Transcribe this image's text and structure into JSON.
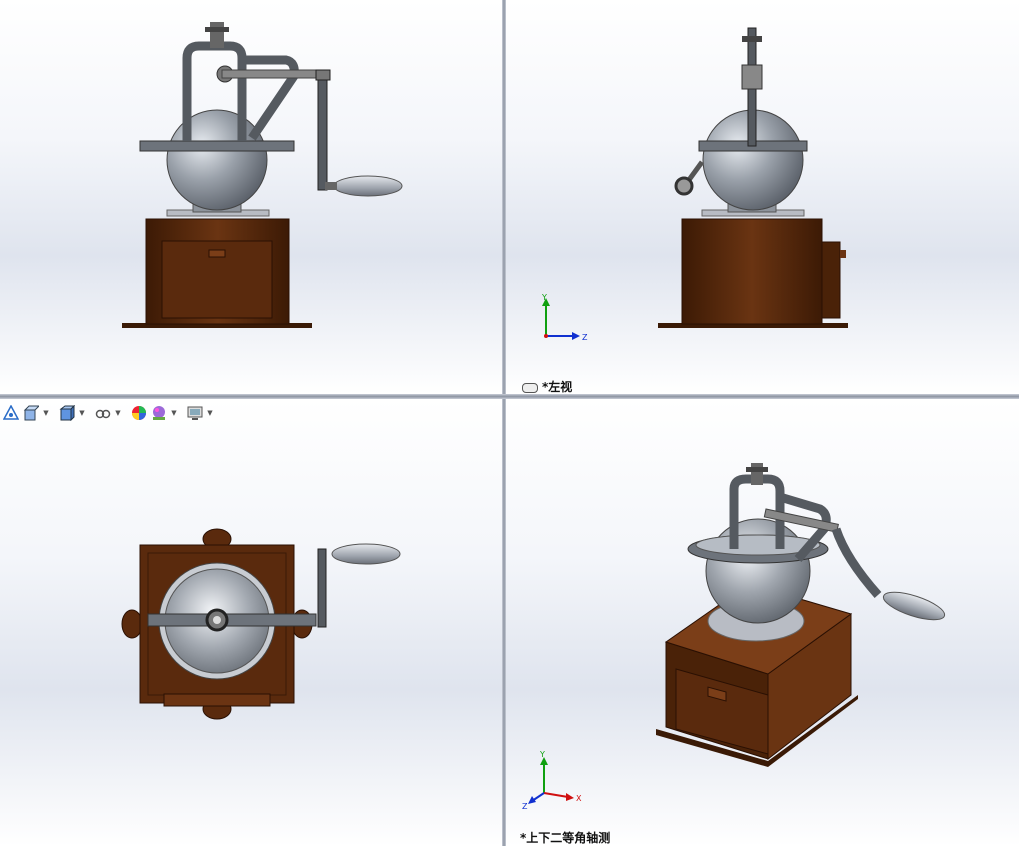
{
  "viewports": {
    "front": {
      "label": ""
    },
    "left": {
      "label": "*左视"
    },
    "top": {
      "label": ""
    },
    "iso": {
      "label": "*上下二等角轴测"
    }
  },
  "axes": {
    "x": "X",
    "y": "Y",
    "z": "Z"
  },
  "toolbar": {
    "icons": [
      "view-orientation-icon",
      "display-style-icon",
      "section-view-icon",
      "hide-show-icon",
      "appearance-icon",
      "scene-icon",
      "display-settings-icon"
    ]
  },
  "colors": {
    "wood": "#5a2a0d",
    "metal": "#555a60",
    "bowl": "#9aa0a8",
    "axis_x": "#d01010",
    "axis_y": "#10a010",
    "axis_z": "#1030d0"
  }
}
